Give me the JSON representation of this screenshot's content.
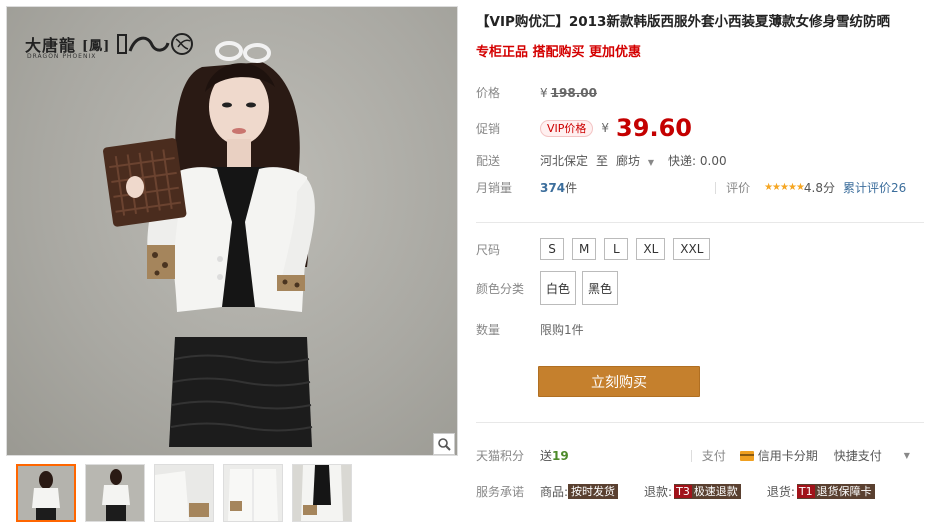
{
  "brand": {
    "name": "大唐龍",
    "sub": "DRAGON  PHOENIX",
    "bracket": "[鳳]"
  },
  "title": "【VIP购优汇】2013新款韩版西服外套小西装夏薄款女修身雪纺防晒",
  "subtitle": "专柜正品 搭配购买 更加优惠",
  "price": {
    "label": "价格",
    "yen": "¥",
    "original": "198.00"
  },
  "promo": {
    "label": "促销",
    "tag": "VIP价格",
    "yen": "¥",
    "value": "39.60"
  },
  "shipping": {
    "label": "配送",
    "from": "河北保定",
    "to_word": "至",
    "dest": "廊坊",
    "express": "快递: 0.00"
  },
  "sales": {
    "label": "月销量",
    "count": "374",
    "unit": "件",
    "review_label": "评价",
    "stars": "★★★★★",
    "score": "4.8分",
    "cumulative": "累计评价26"
  },
  "size": {
    "label": "尺码",
    "options": [
      "S",
      "M",
      "L",
      "XL",
      "XXL"
    ]
  },
  "color": {
    "label": "颜色分类",
    "options": [
      "白色",
      "黑色"
    ]
  },
  "quantity": {
    "label": "数量",
    "limit": "限购1件"
  },
  "buy_button": "立刻购买",
  "points": {
    "label": "天猫积分",
    "send": "送",
    "value": "19",
    "pay_label": "支付",
    "card": "信用卡分期",
    "quick": "快捷支付"
  },
  "service": {
    "label": "服务承诺",
    "goods_label": "商品:",
    "goods_tag": "按时发货",
    "refund_label": "退款:",
    "refund_t": "T3",
    "refund_tag": "极速退款",
    "return_label": "退货:",
    "return_t": "T1",
    "return_tag": "退货保障卡"
  },
  "icons": {
    "zoom": "magnifier-icon",
    "dropdown": "triangle-down-icon",
    "card": "credit-card-icon"
  },
  "colors": {
    "accent": "#c40000",
    "buy": "#c5802d",
    "star": "#f5a623",
    "link": "#3c6e9c"
  }
}
